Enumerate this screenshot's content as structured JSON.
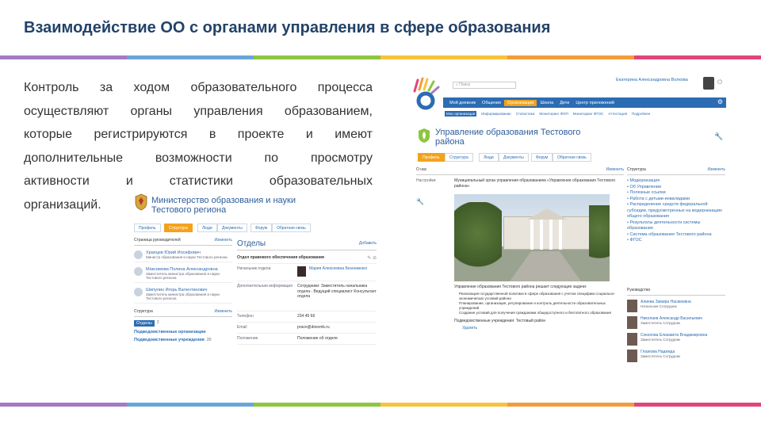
{
  "slide": {
    "title": "Взаимодействие ОО с органами управления в сфере образования",
    "body_lines": [
      "Контроль за ходом образовательного процесса",
      "осуществляют органы управления образованием,",
      "которые регистрируются в проекте и имеют",
      "дополнительные возможности по просмотру",
      "активности и статистики образовательных",
      "организаций."
    ],
    "stripe_colors": [
      "#a47bc2",
      "#6aa5da",
      "#8dc63f",
      "#f7c33c",
      "#f39c3d",
      "#e0457b"
    ]
  },
  "shot_left": {
    "org_name_1": "Министерство образования и науки",
    "org_name_2": "Тестового региона",
    "tabs": [
      "Профиль",
      "Структура",
      "Люди",
      "Документы",
      "Форум",
      "Обратная связь"
    ],
    "leaders_header": "Страница руководителей",
    "leaders_edit": "Изменить",
    "leaders": [
      {
        "name": "Храпцев Юрий Иосифович",
        "role": "Министр образования и науки Тестового региона"
      },
      {
        "name": "Максимова Полина Александровна",
        "role": "Заместитель министра образования и науки Тестового региона"
      },
      {
        "name": "Шипулин Игорь Валентинович",
        "role": "Заместитель министра образования и науки Тестового региона"
      }
    ],
    "structure_header": "Структура",
    "structure_edit": "Изменить",
    "structure_items": [
      "Отделы",
      "Подведомственные организации",
      "Подведомственные учреждения"
    ],
    "structure_counts": [
      "2",
      "",
      "20"
    ],
    "dept_title": "Отделы",
    "dept_action": "Добавить",
    "dept_name": "Отдел правового обеспечения образования",
    "dept_rows": [
      {
        "label": "Начальник отдела",
        "value": "Мария Алексеевна Безноженко"
      },
      {
        "label": "Дополнительная информация",
        "value": "Сотрудники: Заместитель начальника отдела - Ведущий специалист Консультант отдела"
      },
      {
        "label": "Телефон",
        "value": "234 45 66"
      },
      {
        "label": "Email",
        "value": "pravo@dnevnik.ru"
      },
      {
        "label": "Положение",
        "value": "Положение об отделе"
      }
    ]
  },
  "shot_right": {
    "search_placeholder": "Поиск",
    "user_name": "Екатерина Александровна Волкова",
    "nav": [
      "Мой дневник",
      "Общение",
      "Организации",
      "Школа",
      "Дети",
      "Центр приложений"
    ],
    "subnav": [
      "Мои организации",
      "Информирование",
      "Статистика",
      "Мониторинг ФОП",
      "Мониторинг ФГОС",
      "Аттестация",
      "Подробнее"
    ],
    "org_name_1": "Управление образования Тестового",
    "org_name_2": "района",
    "tabs": [
      "Профиль",
      "Структура",
      "Люди",
      "Документы",
      "Форум",
      "Обратная связь"
    ],
    "about_header": "О нас",
    "about_edit": "Изменить",
    "settings": "Настройки",
    "about_text": "Муниципальный орган управления образованием «Управление образования Тестового района»",
    "photo_caption": "Управление образования Тестового района решает следующие задачи:",
    "tasks": [
      "Реализация государственной политики в сфере образования с учетом специфики социально-экономических условий района",
      "Планирование, организация, регулирование и контроль деятельности образовательных учреждений",
      "Создание условий для получения гражданами общедоступного и бесплатного образования"
    ],
    "footer_line": "Подведомственные учреждения: Тестовый район",
    "delete_link": "Удалить",
    "structure_header": "Структура",
    "structure_edit": "Изменить",
    "structure_items": [
      "Модернизация",
      "Об Управлении",
      "Полезные ссылки",
      "Работа с детьми-инвалидами",
      "Распределение средств федеральной субсидии, предусмотренных на модернизацию общего образования",
      "Результаты деятельности системы образования",
      "Система образования Тестового района",
      "ФГОС"
    ],
    "leaders_header": "Руководство",
    "leaders": [
      {
        "name": "Алиева Замира Насимовна",
        "role": "Начальник Сотрудник"
      },
      {
        "name": "Николаев Александр Васильевич",
        "role": "Заместитель Сотрудник"
      },
      {
        "name": "Соколова Елизавета Владимировна",
        "role": "Заместитель Сотрудник"
      },
      {
        "name": "Глазкова Надежда",
        "role": "Заместитель Сотрудник"
      }
    ]
  }
}
